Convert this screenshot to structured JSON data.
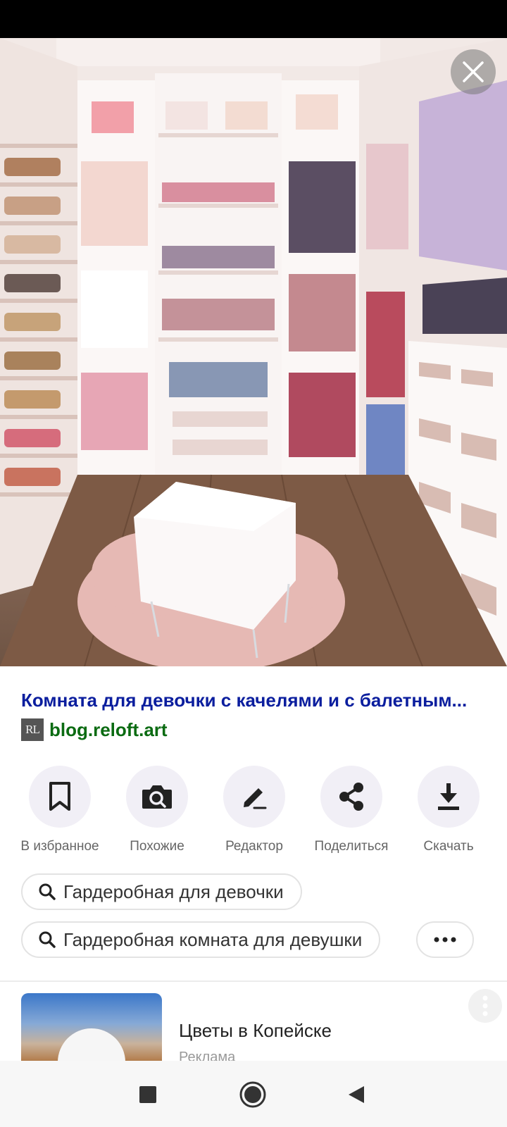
{
  "photo": {
    "description_icon": "walk-in-closet-photo"
  },
  "close": {
    "icon": "close-icon"
  },
  "result": {
    "title": "Комната для девочки с качелями и с балетным...",
    "source_favicon_text": "RL",
    "source_domain": "blog.reloft.art"
  },
  "actions": [
    {
      "label": "В избранное",
      "icon": "bookmark-icon"
    },
    {
      "label": "Похожие",
      "icon": "camera-search-icon"
    },
    {
      "label": "Редактор",
      "icon": "pencil-icon"
    },
    {
      "label": "Поделиться",
      "icon": "share-icon"
    },
    {
      "label": "Скачать",
      "icon": "download-icon"
    }
  ],
  "suggestions": [
    {
      "text": "Гардеробная для девочки",
      "icon": "search-icon"
    },
    {
      "text": "Гардеробная комната для девушки",
      "icon": "search-icon"
    }
  ],
  "more_suggestions": {
    "icon": "more-horizontal-icon"
  },
  "ad": {
    "title": "Цветы в Копейске",
    "label": "Реклама",
    "menu_icon": "more-vertical-icon"
  },
  "nav": {
    "recents_icon": "square-icon",
    "home_icon": "circle-icon",
    "back_icon": "triangle-back-icon"
  },
  "colors": {
    "title_link": "#0b1e9e",
    "domain_link": "#0b6b12",
    "action_bg": "#f1eff6"
  }
}
